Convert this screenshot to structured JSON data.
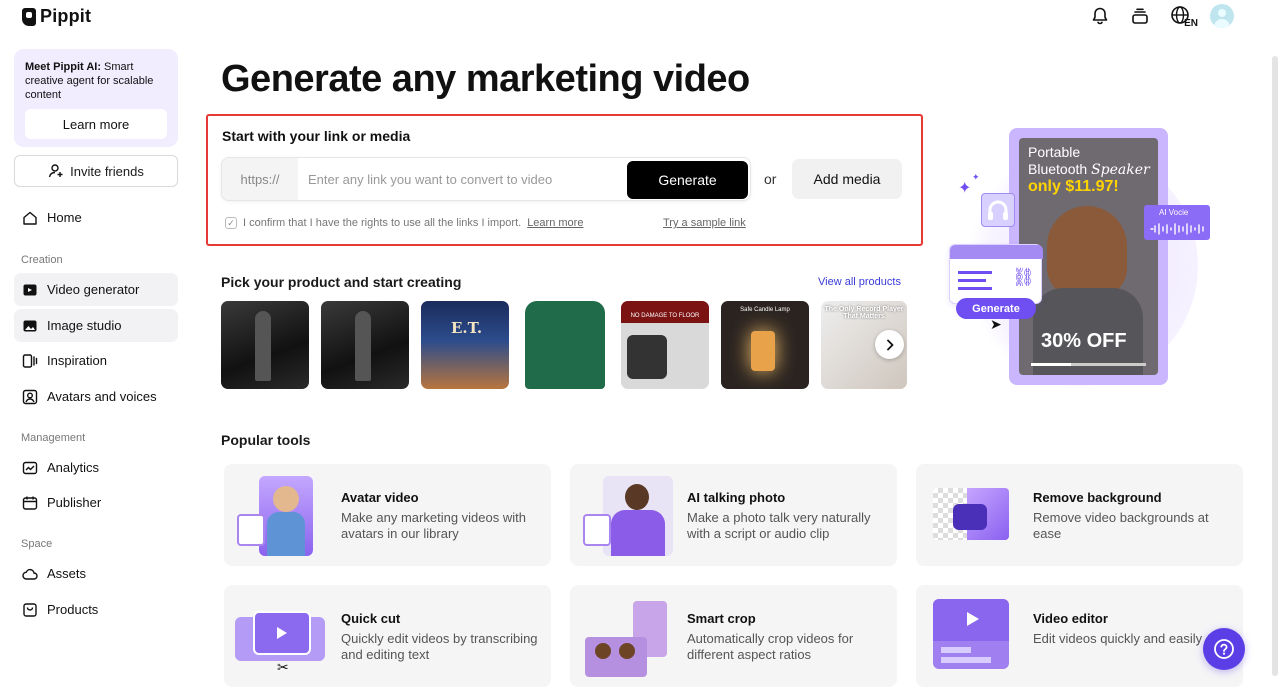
{
  "brand": {
    "name": "Pippit"
  },
  "top_bar": {
    "lang_code": "EN"
  },
  "sidebar": {
    "promo_title": "Meet Pippit AI:",
    "promo_text": " Smart creative agent for scalable content",
    "learn_more": "Learn more",
    "invite": "Invite friends",
    "home": "Home",
    "section_creation": "Creation",
    "video_generator": "Video generator",
    "image_studio": "Image studio",
    "inspiration": "Inspiration",
    "avatars": "Avatars and voices",
    "section_management": "Management",
    "analytics": "Analytics",
    "publisher": "Publisher",
    "section_space": "Space",
    "assets": "Assets",
    "products": "Products"
  },
  "main": {
    "title": "Generate any marketing video",
    "link_section": {
      "title": "Start with your link or media",
      "prefix": "https://",
      "placeholder": "Enter any link you want to convert to video",
      "generate": "Generate",
      "or": "or",
      "add_media": "Add media",
      "confirm_text": "I confirm that I have the rights to use all the links I import.",
      "confirm_link": "Learn more",
      "sample_link": "Try a sample link"
    },
    "products": {
      "title": "Pick your product and start creating",
      "view_all": "View all products",
      "items": [
        {
          "caption": ""
        },
        {
          "caption": ""
        },
        {
          "caption": "E.T."
        },
        {
          "caption": ""
        },
        {
          "caption": "NO DAMAGE TO FLOOR"
        },
        {
          "caption": "Safe Candle Lamp"
        },
        {
          "caption": "The Only Record Player That Matters"
        }
      ]
    },
    "popular_tools": {
      "title": "Popular tools",
      "items": [
        {
          "name": "Avatar video",
          "desc": "Make any marketing videos with avatars in our library"
        },
        {
          "name": "AI talking photo",
          "desc": "Make a photo talk very naturally with a script or audio clip"
        },
        {
          "name": "Remove background",
          "desc": "Remove video backgrounds at ease"
        },
        {
          "name": "Quick cut",
          "desc": "Quickly edit videos by transcribing and editing text"
        },
        {
          "name": "Smart crop",
          "desc": "Automatically crop videos for different aspect ratios"
        },
        {
          "name": "Video editor",
          "desc": "Edit videos quickly and easily"
        }
      ]
    },
    "hero": {
      "line1": "Portable",
      "line2a": "Bluetooth ",
      "line2b": "Speaker",
      "price": "only $11.97!",
      "discount": "30% OFF",
      "voice_label": "AI Vocie",
      "generate_pill": "Generate"
    }
  },
  "colors": {
    "accent": "#5b3ee6",
    "highlight_border": "#e53935",
    "promo_bg": "#f1ecfe"
  }
}
